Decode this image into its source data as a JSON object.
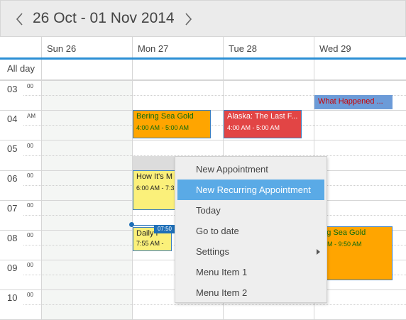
{
  "header": {
    "date_range": "26 Oct - 01 Nov 2014"
  },
  "days": [
    "Sun 26",
    "Mon 27",
    "Tue 28",
    "Wed 29"
  ],
  "allday_label": "All day",
  "hours": [
    {
      "label": "03",
      "sub": "00"
    },
    {
      "label": "04",
      "sub": "AM"
    },
    {
      "label": "05",
      "sub": "00"
    },
    {
      "label": "06",
      "sub": "00"
    },
    {
      "label": "07",
      "sub": "00"
    },
    {
      "label": "08",
      "sub": "00"
    },
    {
      "label": "09",
      "sub": "00"
    },
    {
      "label": "10",
      "sub": "00"
    }
  ],
  "appointments": [
    {
      "title": "Bering Sea Gold",
      "time": "4:00 AM - 5:00 AM"
    },
    {
      "title": "Alaska: The Last F...",
      "time": "4:00 AM - 5:00 AM"
    },
    {
      "title": "What Happened ..."
    },
    {
      "title": "How It's M",
      "time": "6:00 AM - 7:3"
    },
    {
      "title": "Daily P",
      "time": "7:55 AM -"
    },
    {
      "title": "ring Sea Gold",
      "time": "6 AM - 9:50 AM"
    }
  ],
  "current_time": "07:50",
  "context_menu": {
    "items": [
      "New Appointment",
      "New Recurring Appointment",
      "Today",
      "Go to date",
      "Settings",
      "Menu Item 1",
      "Menu Item 2"
    ]
  },
  "colors": {
    "accent": "#2b8fd5",
    "menu_highlight": "#5aaae6",
    "orange": "#ffa500",
    "red": "#e24545",
    "blue": "#6c9bd8",
    "yellow": "#fbf07a"
  }
}
